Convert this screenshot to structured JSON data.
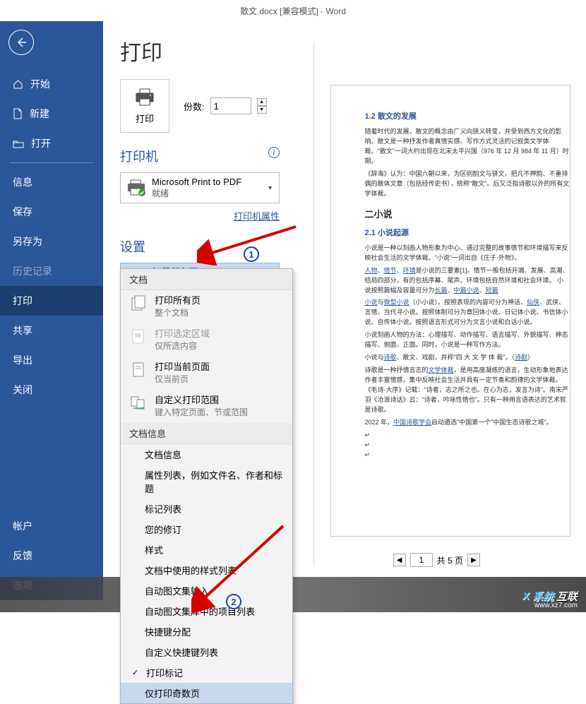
{
  "titlebar": "散文.docx  [兼容模式]  -  Word",
  "sidebar": {
    "start": "开始",
    "new": "新建",
    "open": "打开",
    "info": "信息",
    "save": "保存",
    "saveas": "另存为",
    "history": "历史记录",
    "print": "打印",
    "share": "共享",
    "export": "导出",
    "close": "关闭",
    "account": "帐户",
    "feedback": "反馈",
    "options": "选项"
  },
  "page": {
    "title": "打印",
    "print_btn": "打印",
    "copies_label": "份数:",
    "copies_value": "1",
    "printer_section": "打印机",
    "printer_name": "Microsoft Print to PDF",
    "printer_status": "就绪",
    "printer_props": "打印机属性",
    "settings_section": "设置",
    "settings_main": "打印所有页",
    "settings_sub": "整个文档"
  },
  "dropdown": {
    "header1": "文档",
    "it1": "打印所有页",
    "it1s": "整个文档",
    "it2": "打印选定区域",
    "it2s": "仅所选内容",
    "it3": "打印当前页面",
    "it3s": "仅当前页",
    "it4": "自定义打印范围",
    "it4s": "键入特定页面、节或范围",
    "header2": "文档信息",
    "s1": "文档信息",
    "s2": "属性列表，例如文件名、作者和标题",
    "s3": "标记列表",
    "s4": "您的修订",
    "s5": "样式",
    "s6": "文档中使用的样式列表",
    "s7": "自动图文集输入",
    "s8": "自动图文集库中的项目列表",
    "s9": "快捷键分配",
    "s10": "自定义快捷键列表",
    "s11": "打印标记",
    "s12": "仅打印奇数页"
  },
  "preview": {
    "h1": "1.2 散文的发展",
    "p1": "随着时代的发展，散文的概念由广义向狭义转变，并受到西方文化的影响。散文是一种抒发作者真情实感、写作方式灵活的记叙类文学体裁。\"散文\"一词大约出现在北宋太平兴国（976 年 12 月 984 年 11 月）时期。",
    "p2": "《辞海》认为：中国六朝以来，为区别韵文与骈文，把凡不押韵、不重排偶的散体文章（包括经传史书），统称\"散文\"。后又泛指诗歌以外的所有文学体裁。",
    "h2": "二小说",
    "h3": "2.1 小说起源",
    "p3": "小说是一种以刻画人物形象为中心、通过完整的故事情节和环境描写来反映社会生活的文学体裁。\"小说\"一词出自《庄子·外物》。",
    "p4a": "人物",
    "p4b": "情节",
    "p4c": "环境",
    "p4": "是小说的三要素[1]。情节一般包括开端、发展、高潮、结局四部分，有的包括序幕、尾声。环境包括自然环境和社会环境。 小说按照篇幅及容量可分为",
    "p5a": "长篇",
    "p5b": "中篇小说",
    "p5c": "短篇",
    "p6a": "小说",
    "p6b": "微型小说",
    "p6": "（小小说）。按照表现的内容可分为神话、",
    "p6c": "仙侠",
    "p6d": "、武侠、言情、当代寻小说。按照体制可分为章回体小说、日记体小说、书信体小说、自传体小说。按照语言形式可分为文言小说和白话小说。",
    "p7": "小说刻画人物的方法：心理描写、动作描写、语言描写、外貌描写、神态描写、侧面、正面。同时，小说是一种写作方法。",
    "p8a": "小说与",
    "p8b": "诗歌",
    "p8": "、散文、戏剧，并称\"四 大 文 学 体 裁\"。（",
    "p8c": "诗剧",
    "p8d": "）",
    "p9": "诗歌是一种抒情言志的",
    "p9a": "文学体裁",
    "p9b": "，是用高度凝练的语言，生动形象地表达作者丰富情感，集中反映社会生活并具有一定节奏和韵律的文学体裁。《毛诗-大序》记载：\"诗者，志之所之也。在心为志，发言为诗\"。南宋严羽《沧浪诗话》云：\"诗者，吟咏性情也\"。只有一种用言语表达的艺术就是诗歌。",
    "p10": "2022 年，",
    "p10a": "中国诗歌学会",
    "p10b": "启动遴选\"中国第一个\"中国生态诗歌之城\"。"
  },
  "pagenav": {
    "current": "1",
    "total": "共 5 页"
  },
  "watermark": {
    "brand": "系统",
    "rest": "互联",
    "url": "www.xz7.com"
  },
  "callouts": {
    "c1": "1",
    "c2": "2"
  }
}
